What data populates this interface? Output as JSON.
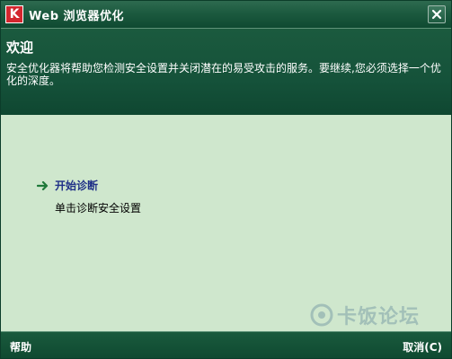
{
  "window": {
    "title": "Web 浏览器优化",
    "logo_letter": "K"
  },
  "header": {
    "title": "欢迎",
    "description": "安全优化器将帮助您检测安全设置并关闭潜在的易受攻击的服务。要继续,您必须选择一个优化的深度。"
  },
  "main": {
    "action_label": "开始诊断",
    "action_description": "单击诊断安全设置"
  },
  "footer": {
    "help_label": "帮助",
    "cancel_label": "取消(C)"
  },
  "watermark": {
    "text": "卡饭论坛"
  },
  "icons": {
    "logo": "kaspersky-k-icon",
    "close": "close-icon",
    "action": "arrow-right-icon"
  },
  "colors": {
    "title_bar": "#1c5a3f",
    "body_bg": "#cfe7cd",
    "link": "#1e2f87",
    "arrow": "#1f7a3a",
    "logo_red": "#d3262e"
  }
}
